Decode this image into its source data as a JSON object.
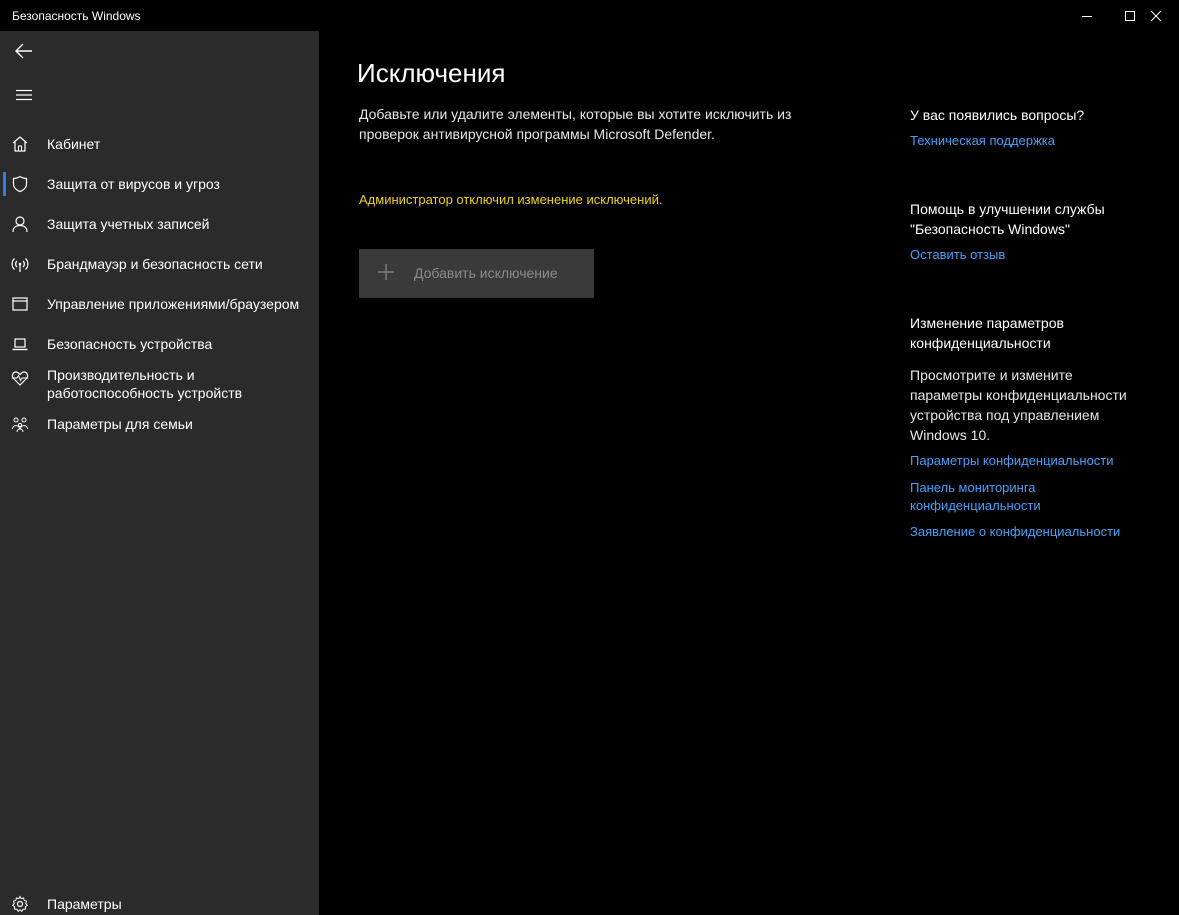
{
  "window": {
    "title": "Безопасность Windows",
    "controls": [
      "minimize-icon",
      "maximize-icon",
      "close-icon"
    ]
  },
  "sidebar": {
    "back_icon": "back-arrow-icon",
    "menu_icon": "hamburger-icon",
    "items": [
      {
        "label": "Кабинет",
        "icon": "home-icon",
        "selected": false
      },
      {
        "label": "Защита от вирусов и угроз",
        "icon": "shield-icon",
        "selected": true
      },
      {
        "label": "Защита учетных записей",
        "icon": "person-icon",
        "selected": false
      },
      {
        "label": "Брандмауэр и безопасность сети",
        "icon": "wireless-icon",
        "selected": false
      },
      {
        "label": "Управление приложениями/браузером",
        "icon": "app-window-icon",
        "selected": false
      },
      {
        "label": "Безопасность устройства",
        "icon": "laptop-icon",
        "selected": false
      },
      {
        "label": "Производительность и работоспособность устройств",
        "label_line1": "Производительность и",
        "label_line2": "работоспособность устройств",
        "icon": "heart-pulse-icon",
        "selected": false
      },
      {
        "label": "Параметры для семьи",
        "icon": "family-icon",
        "selected": false
      }
    ],
    "settings": {
      "label": "Параметры",
      "icon": "gear-icon"
    }
  },
  "main": {
    "title": "Исключения",
    "description_line1": "Добавьте или удалите элементы, которые вы хотите исключить из",
    "description_line2": "проверок антивирусной программы Microsoft Defender.",
    "admin_warning": "Администратор отключил изменение исключений.",
    "add_button_label": "Добавить исключение"
  },
  "right_panel": {
    "questions": {
      "heading": "У вас появились вопросы?",
      "link": "Техническая поддержка"
    },
    "improve": {
      "heading_line1": "Помощь в улучшении службы",
      "heading_line2": "\"Безопасность Windows\"",
      "link": "Оставить отзыв"
    },
    "privacy": {
      "heading_line1": "Изменение параметров",
      "heading_line2": "конфиденциальности",
      "text_line1": "Просмотрите и измените",
      "text_line2": "параметры конфиденциальности",
      "text_line3": "устройства под управлением",
      "text_line4": "Windows 10.",
      "link1": "Параметры конфиденциальности",
      "link2_line1": "Панель мониторинга",
      "link2_line2": "конфиденциальности",
      "link3": "Заявление о конфиденциальности"
    }
  },
  "colors": {
    "accent": "#2f7fd8",
    "link": "#4aa0f5",
    "warning": "#f2d216",
    "sidebar_bg": "#2b2b2b",
    "main_bg": "#000000"
  }
}
